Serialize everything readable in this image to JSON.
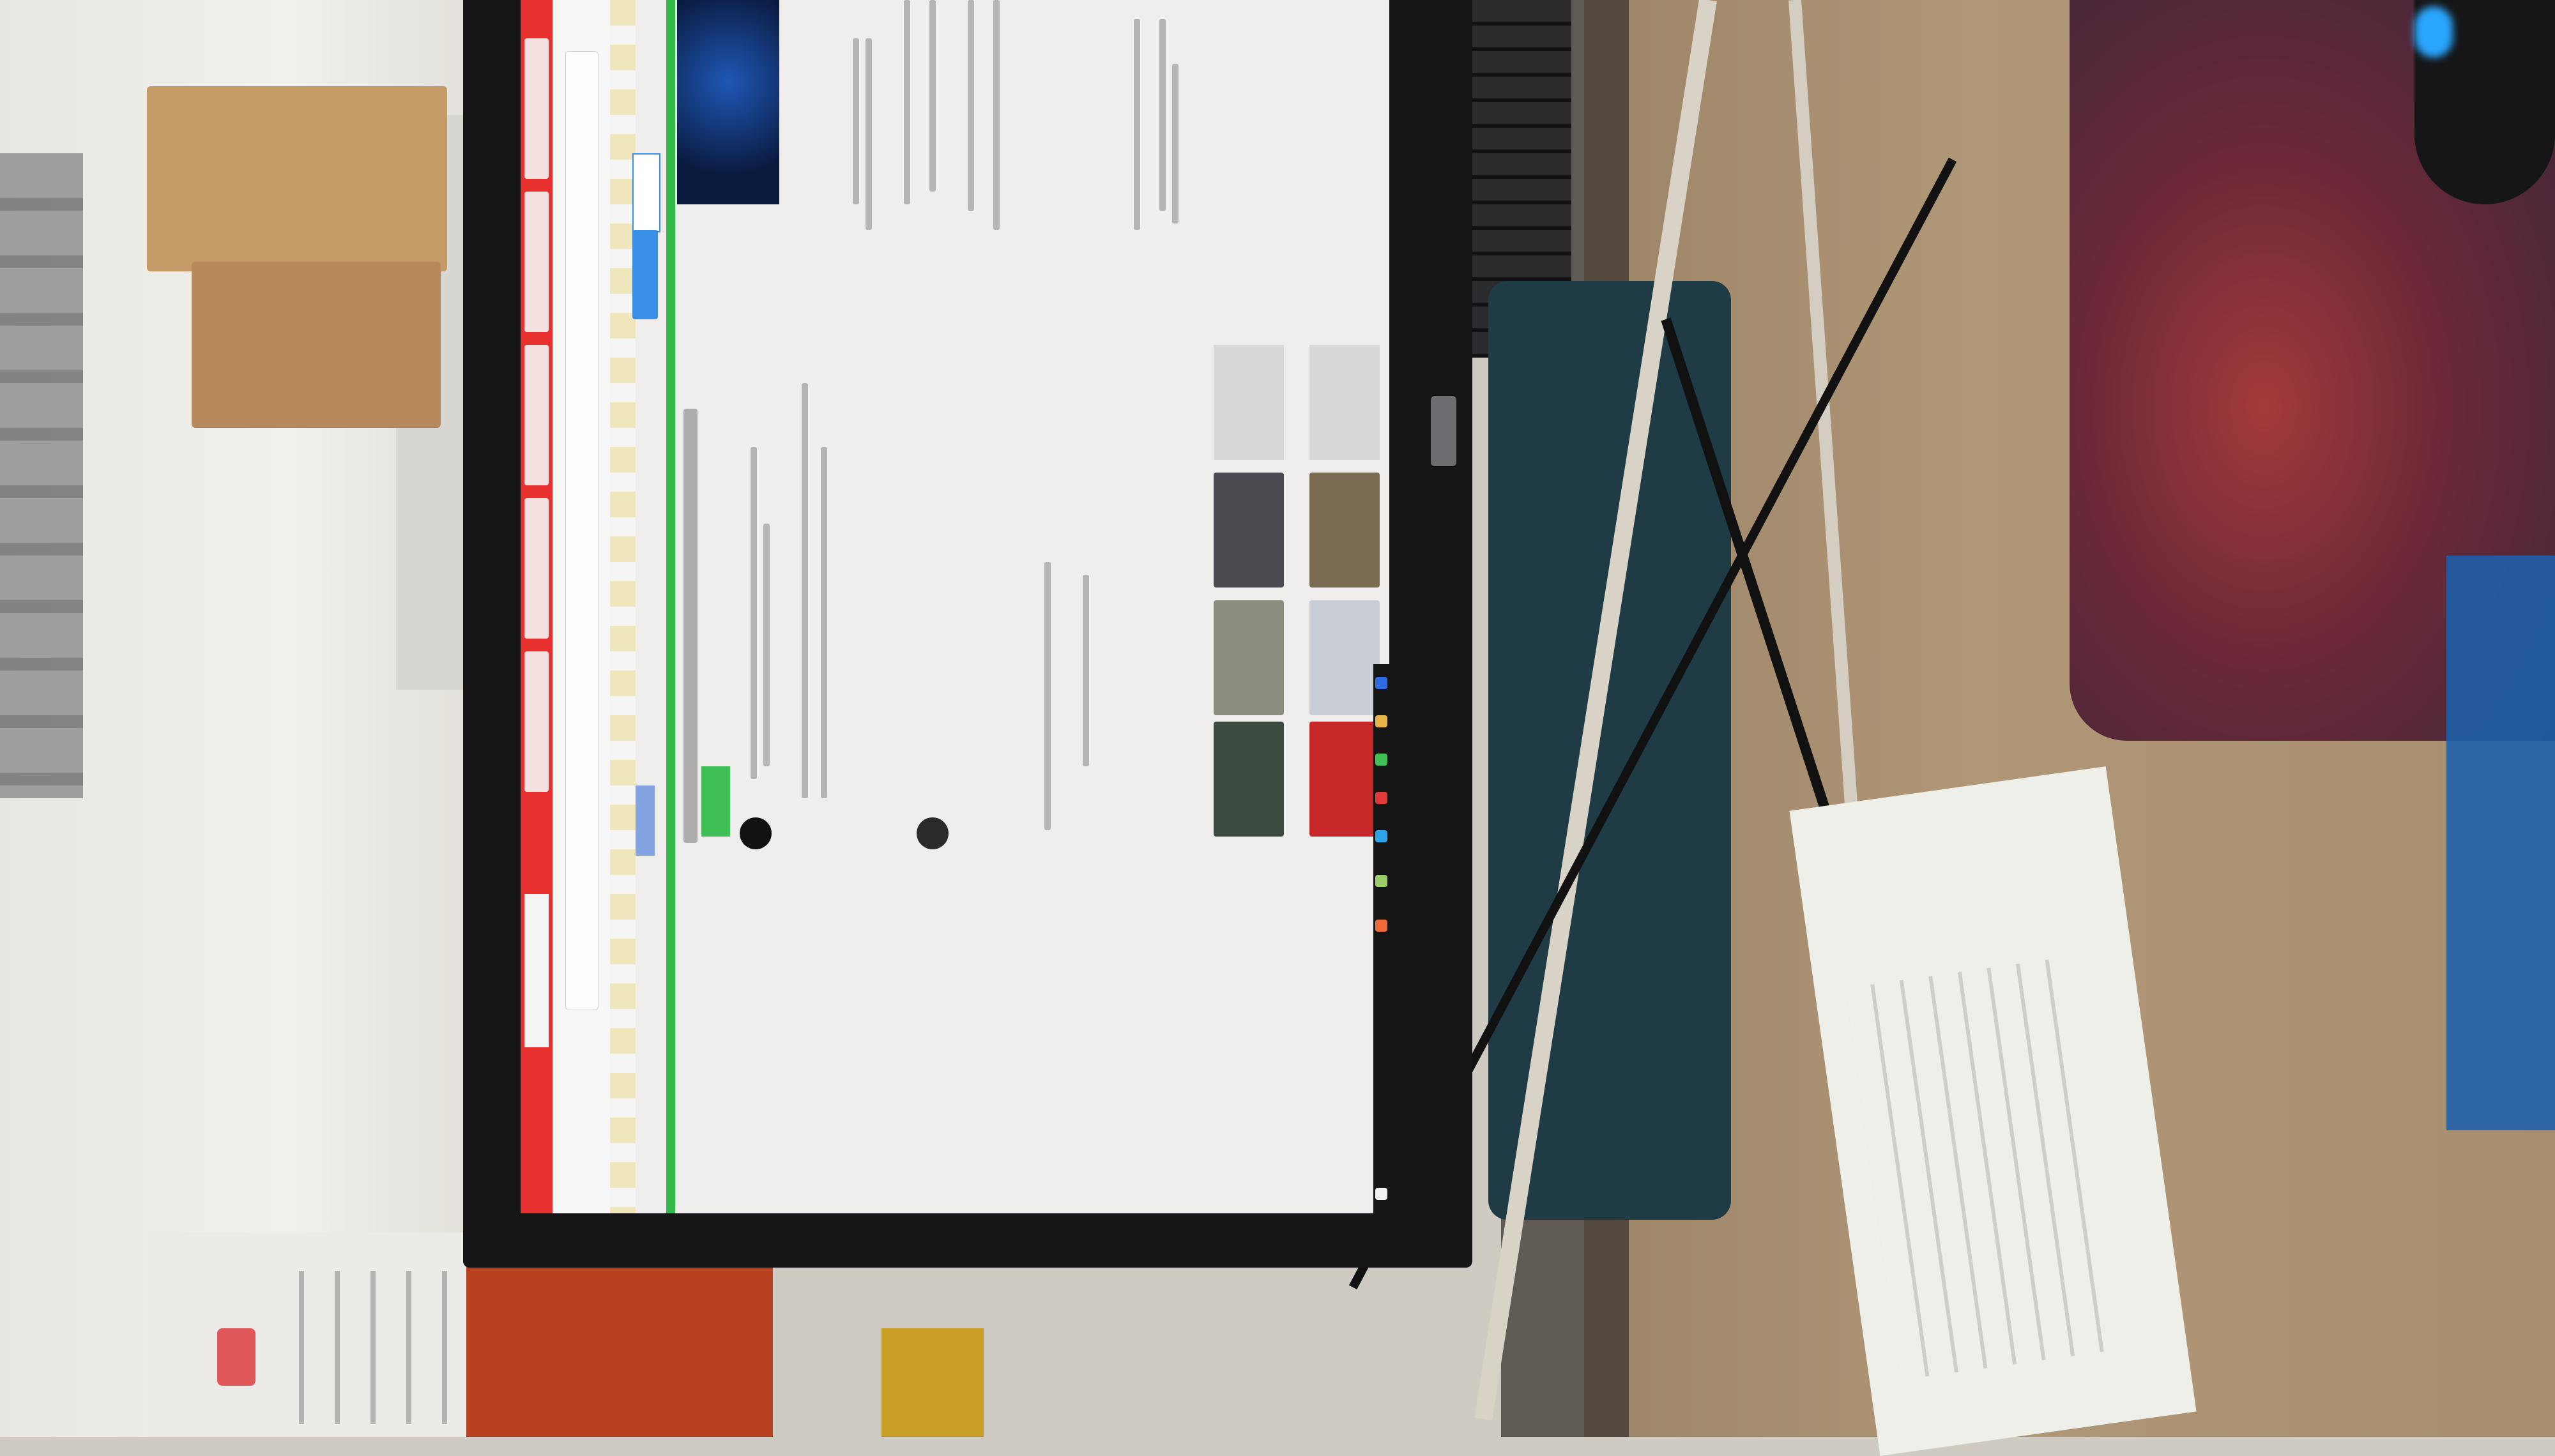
{
  "scene": {
    "description_colors": {
      "browser_accent": "#e8302f",
      "green_strip": "#33b84a",
      "search_button": "#3a8ee6",
      "desk": "#b09777",
      "mousepad": "#6a2838"
    }
  },
  "browser": {
    "tabs": [
      "",
      "",
      "",
      "",
      "",
      ""
    ],
    "address": ""
  },
  "page": {
    "banner_text": "",
    "headline": "",
    "label": ""
  },
  "taskbar": {
    "icons": [
      "chrome-icon",
      "folder-icon",
      "mail-icon",
      "wechat-icon",
      "qq-icon",
      "search-icon",
      "settings-icon",
      "windows-icon"
    ]
  }
}
